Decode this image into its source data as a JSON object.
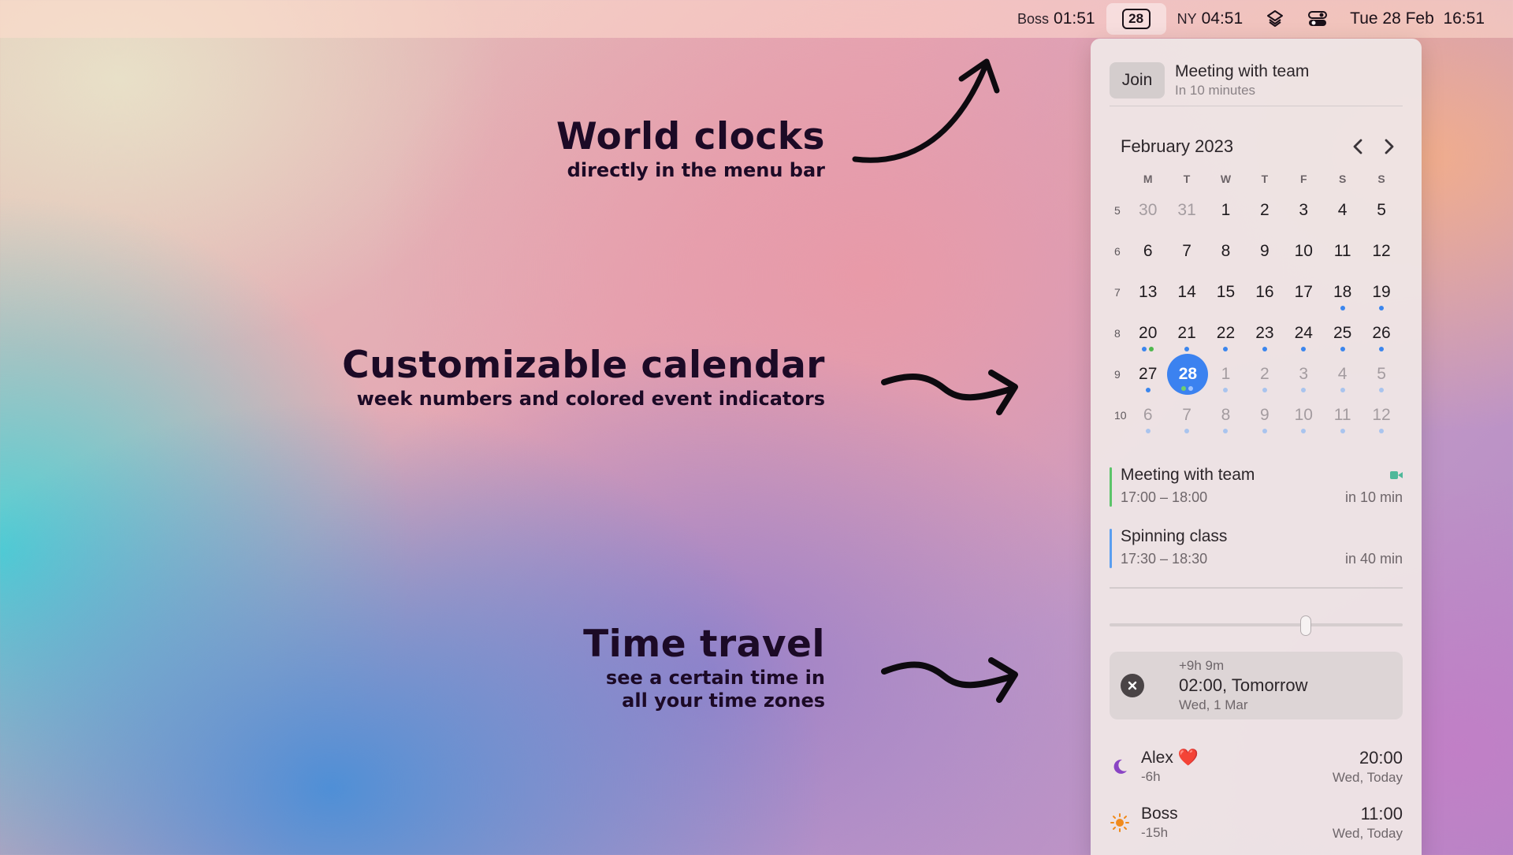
{
  "menubar": {
    "boss_label": "Boss",
    "boss_time": "01:51",
    "calendar_badge": "28",
    "ny_label": "NY",
    "ny_time": "04:51",
    "datetime": "Tue 28 Feb  16:51",
    "icons": [
      "calendar-badge-icon",
      "layers-icon",
      "control-center-icon"
    ]
  },
  "features": [
    {
      "title": "World clocks",
      "subtitle": "directly in the menu bar"
    },
    {
      "title": "Customizable calendar",
      "subtitle": "week numbers and colored event indicators"
    },
    {
      "title": "Time travel",
      "subtitle": "see a certain time in\nall your time zones"
    }
  ],
  "panel": {
    "next_meeting": {
      "join_label": "Join",
      "title": "Meeting with team",
      "subtitle": "In 10 minutes"
    },
    "calendar": {
      "month_label": "February 2023",
      "weekdays": [
        "M",
        "T",
        "W",
        "T",
        "F",
        "S",
        "S"
      ],
      "weeks": [
        {
          "num": "5",
          "days": [
            {
              "d": "30",
              "muted": true,
              "dots": []
            },
            {
              "d": "31",
              "muted": true,
              "dots": []
            },
            {
              "d": "1",
              "dots": []
            },
            {
              "d": "2",
              "dots": []
            },
            {
              "d": "3",
              "dots": []
            },
            {
              "d": "4",
              "dots": []
            },
            {
              "d": "5",
              "dots": []
            }
          ]
        },
        {
          "num": "6",
          "days": [
            {
              "d": "6",
              "dots": []
            },
            {
              "d": "7",
              "dots": []
            },
            {
              "d": "8",
              "dots": []
            },
            {
              "d": "9",
              "dots": []
            },
            {
              "d": "10",
              "dots": []
            },
            {
              "d": "11",
              "dots": []
            },
            {
              "d": "12",
              "dots": []
            }
          ]
        },
        {
          "num": "7",
          "days": [
            {
              "d": "13",
              "dots": []
            },
            {
              "d": "14",
              "dots": []
            },
            {
              "d": "15",
              "dots": []
            },
            {
              "d": "16",
              "dots": []
            },
            {
              "d": "17",
              "dots": []
            },
            {
              "d": "18",
              "dots": [
                "blue"
              ]
            },
            {
              "d": "19",
              "dots": [
                "blue"
              ]
            }
          ]
        },
        {
          "num": "8",
          "days": [
            {
              "d": "20",
              "dots": [
                "blue",
                "green"
              ]
            },
            {
              "d": "21",
              "dots": [
                "blue"
              ]
            },
            {
              "d": "22",
              "dots": [
                "blue"
              ]
            },
            {
              "d": "23",
              "dots": [
                "blue"
              ]
            },
            {
              "d": "24",
              "dots": [
                "blue"
              ]
            },
            {
              "d": "25",
              "dots": [
                "blue"
              ]
            },
            {
              "d": "26",
              "dots": [
                "blue"
              ]
            }
          ]
        },
        {
          "num": "9",
          "days": [
            {
              "d": "27",
              "dots": [
                "blue"
              ]
            },
            {
              "d": "28",
              "today": true,
              "dots": [
                "green",
                "blue"
              ]
            },
            {
              "d": "1",
              "muted": true,
              "dots": [
                "faded"
              ]
            },
            {
              "d": "2",
              "muted": true,
              "dots": [
                "faded"
              ]
            },
            {
              "d": "3",
              "muted": true,
              "dots": [
                "faded"
              ]
            },
            {
              "d": "4",
              "muted": true,
              "dots": [
                "faded"
              ]
            },
            {
              "d": "5",
              "muted": true,
              "dots": [
                "faded"
              ]
            }
          ]
        },
        {
          "num": "10",
          "days": [
            {
              "d": "6",
              "muted": true,
              "dots": [
                "faded"
              ]
            },
            {
              "d": "7",
              "muted": true,
              "dots": [
                "faded"
              ]
            },
            {
              "d": "8",
              "muted": true,
              "dots": [
                "faded"
              ]
            },
            {
              "d": "9",
              "muted": true,
              "dots": [
                "faded"
              ]
            },
            {
              "d": "10",
              "muted": true,
              "dots": [
                "faded"
              ]
            },
            {
              "d": "11",
              "muted": true,
              "dots": [
                "faded"
              ]
            },
            {
              "d": "12",
              "muted": true,
              "dots": [
                "faded"
              ]
            }
          ]
        }
      ]
    },
    "events": [
      {
        "title": "Meeting with team",
        "time": "17:00 – 18:00",
        "until": "in 10 min",
        "color": "#5cc46a",
        "icon": "video-camera-icon"
      },
      {
        "title": "Spinning class",
        "time": "17:30 – 18:30",
        "until": "in 40 min",
        "color": "#5a9ef0"
      }
    ],
    "time_travel": {
      "slider_fraction": 0.67,
      "offset": "+9h 9m",
      "time": "02:00, Tomorrow",
      "date": "Wed, 1 Mar"
    },
    "clocks": [
      {
        "name": "Alex",
        "emoji": "❤️",
        "offset": "-6h",
        "time": "20:00",
        "day": "Wed, Today",
        "icon": "moon-icon"
      },
      {
        "name": "Boss",
        "offset": "-15h",
        "time": "11:00",
        "day": "Wed, Today",
        "icon": "sun-icon"
      }
    ]
  },
  "colors": {
    "accent": "#3b82f0",
    "event_green": "#5cc46a",
    "event_blue": "#5a9ef0",
    "moon": "#8a44c4",
    "sun": "#f08a1c"
  }
}
